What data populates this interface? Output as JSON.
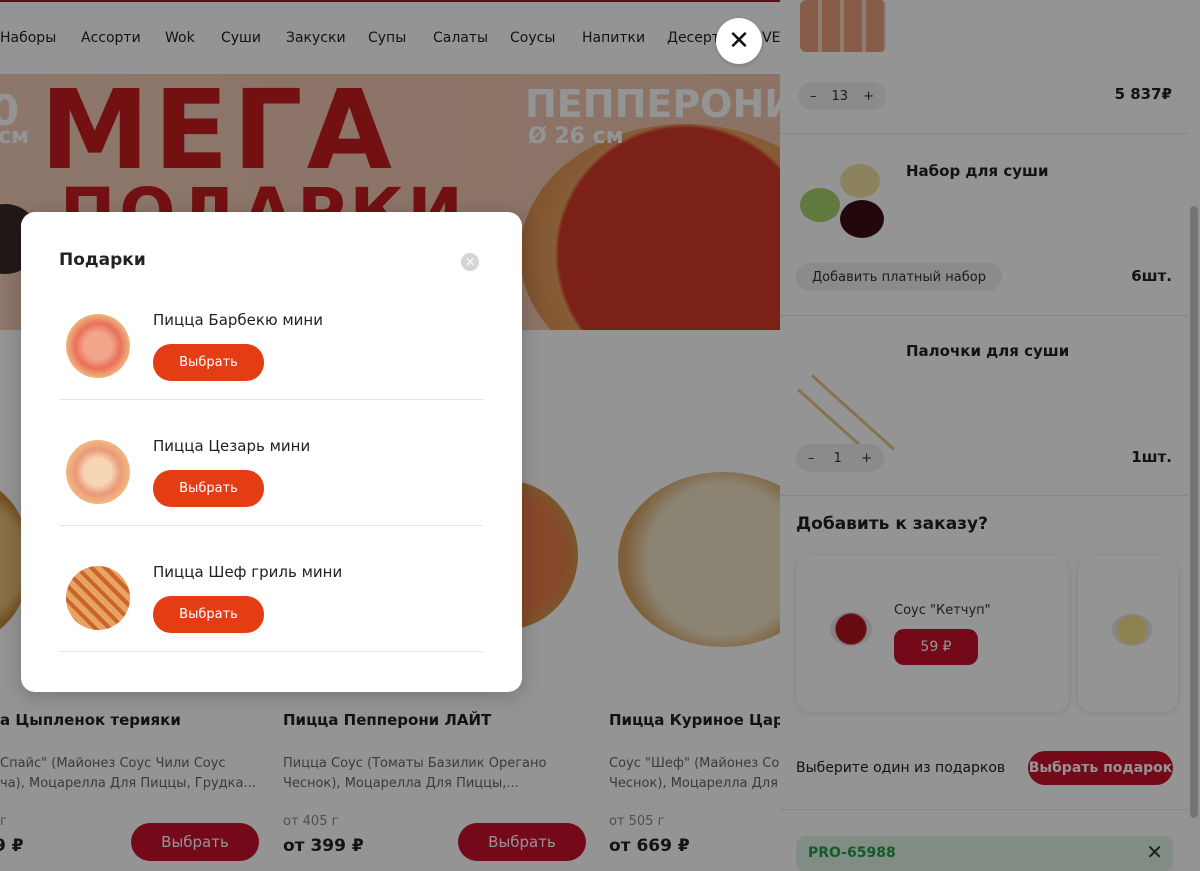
{
  "nav": {
    "items": [
      "Наборы",
      "Ассорти",
      "Wok",
      "Суши",
      "Закуски",
      "Супы",
      "Салаты",
      "Соусы",
      "Напитки",
      "Десерты"
    ],
    "overflow_label": "VEG"
  },
  "banner": {
    "headline_1": "МЕГА",
    "headline_2": "ПОДАРКИ",
    "left_value": "0",
    "left_unit": "см",
    "pizza_name": "ПЕППЕРОНИ",
    "pizza_size": "Ø 26 см"
  },
  "products": [
    {
      "name": "а Цыпленок терияки",
      "desc_1": "Спайс\" (Майонез Соус Чили Соус",
      "desc_2": "ча), Моцарелла Для Пиццы, Грудка...",
      "weight": "г",
      "price": "9 ₽",
      "button": "Выбрать"
    },
    {
      "name": "Пицца Пепперони ЛАЙТ",
      "desc_1": "Пицца Соус (Томаты Базилик Орегано",
      "desc_2": "Чеснок), Моцарелла Для Пиццы,...",
      "weight": "от 405 г",
      "price": "от 399 ₽",
      "button": "Выбрать"
    },
    {
      "name": "Пицца Куриное Царст",
      "desc_1": "Соус \"Шеф\" (Майонез Со",
      "desc_2": "Чеснок), Моцарелла Для",
      "weight": "от 505 г",
      "price": "от 669 ₽",
      "button": ""
    }
  ],
  "close_icon_glyph": "✕",
  "modal": {
    "title": "Подарки",
    "close_glyph": "✕",
    "gifts": [
      {
        "name": "Пицца Барбекю мини",
        "button": "Выбрать"
      },
      {
        "name": "Пицца Цезарь мини",
        "button": "Выбрать"
      },
      {
        "name": "Пицца Шеф гриль мини",
        "button": "Выбрать"
      }
    ]
  },
  "cart": {
    "item1": {
      "minus": "–",
      "qty": "13",
      "plus": "+",
      "price": "5 837₽"
    },
    "item2": {
      "title": "Набор для суши",
      "button": "Добавить платный набор",
      "count": "6шт."
    },
    "item3": {
      "title": "Палочки для суши",
      "minus": "–",
      "qty": "1",
      "plus": "+",
      "count": "1шт."
    },
    "add_title": "Добавить к заказу?",
    "upsell": {
      "name": "Соус \"Кетчуп\"",
      "price": "59 ₽"
    },
    "gift_text": "Выберите один из подарков",
    "gift_button": "Выбрать подарок",
    "promo_code": "PRO-65988",
    "promo_remove": "✕"
  },
  "colors": {
    "brand_red": "#c8102e",
    "modal_button": "#e43d14",
    "promo_bg": "#dff3e3",
    "promo_text": "#1f9d46"
  }
}
